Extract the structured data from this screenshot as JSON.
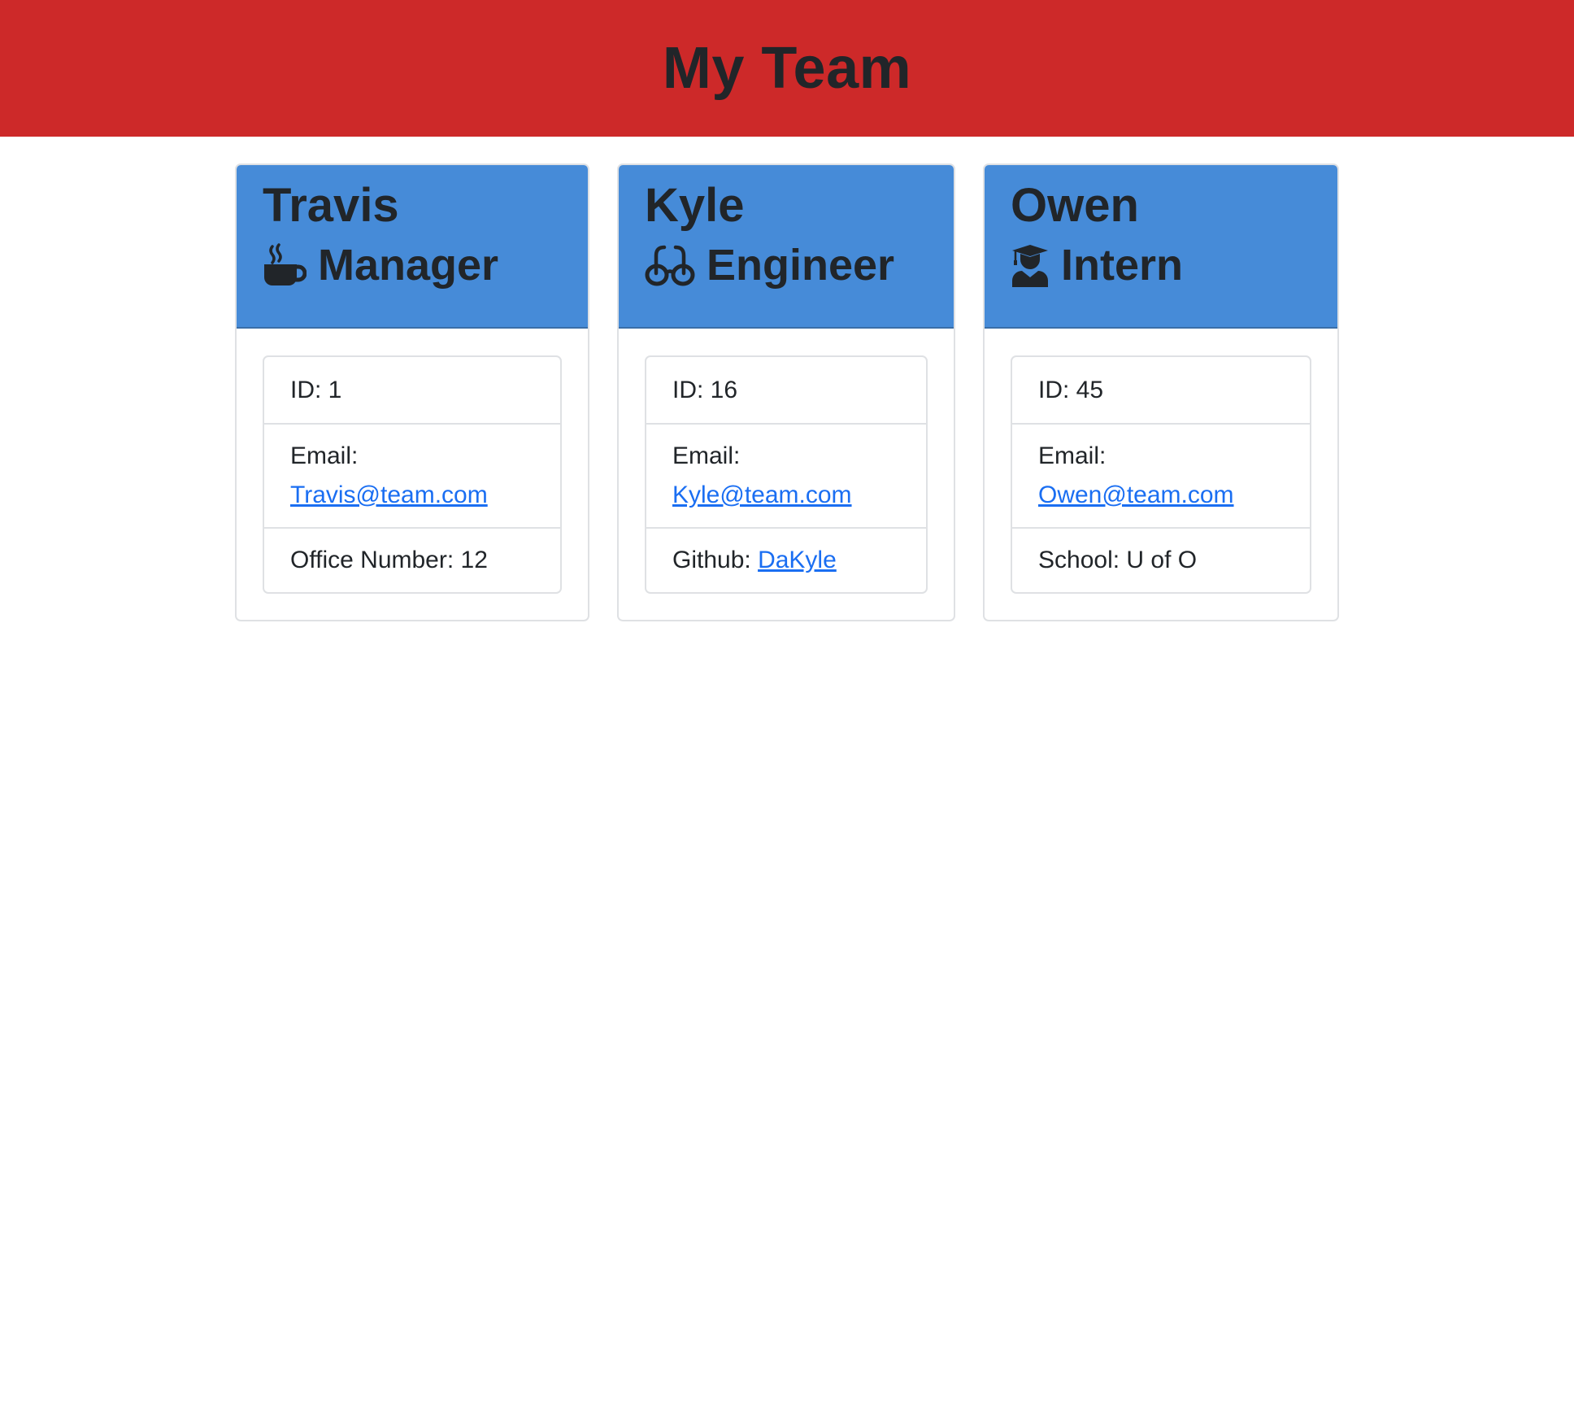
{
  "page": {
    "title": "My Team",
    "colors": {
      "header_bg": "#cd2929",
      "card_header_bg": "#468bd8",
      "link": "#1a6ef2",
      "text": "#212529"
    }
  },
  "team": [
    {
      "name": "Travis",
      "role": "Manager",
      "role_icon": "mug-hot-icon",
      "id_text": "ID: 1",
      "email_label": "Email:",
      "email": "Travis@team.com",
      "extra_label": "Office Number: 12",
      "extra_link": ""
    },
    {
      "name": "Kyle",
      "role": "Engineer",
      "role_icon": "glasses-icon",
      "id_text": "ID: 16",
      "email_label": "Email:",
      "email": "Kyle@team.com",
      "extra_label": "Github: ",
      "extra_link": "DaKyle"
    },
    {
      "name": "Owen",
      "role": "Intern",
      "role_icon": "user-graduate-icon",
      "id_text": "ID: 45",
      "email_label": "Email:",
      "email": "Owen@team.com",
      "extra_label": "School: U of O",
      "extra_link": ""
    }
  ]
}
